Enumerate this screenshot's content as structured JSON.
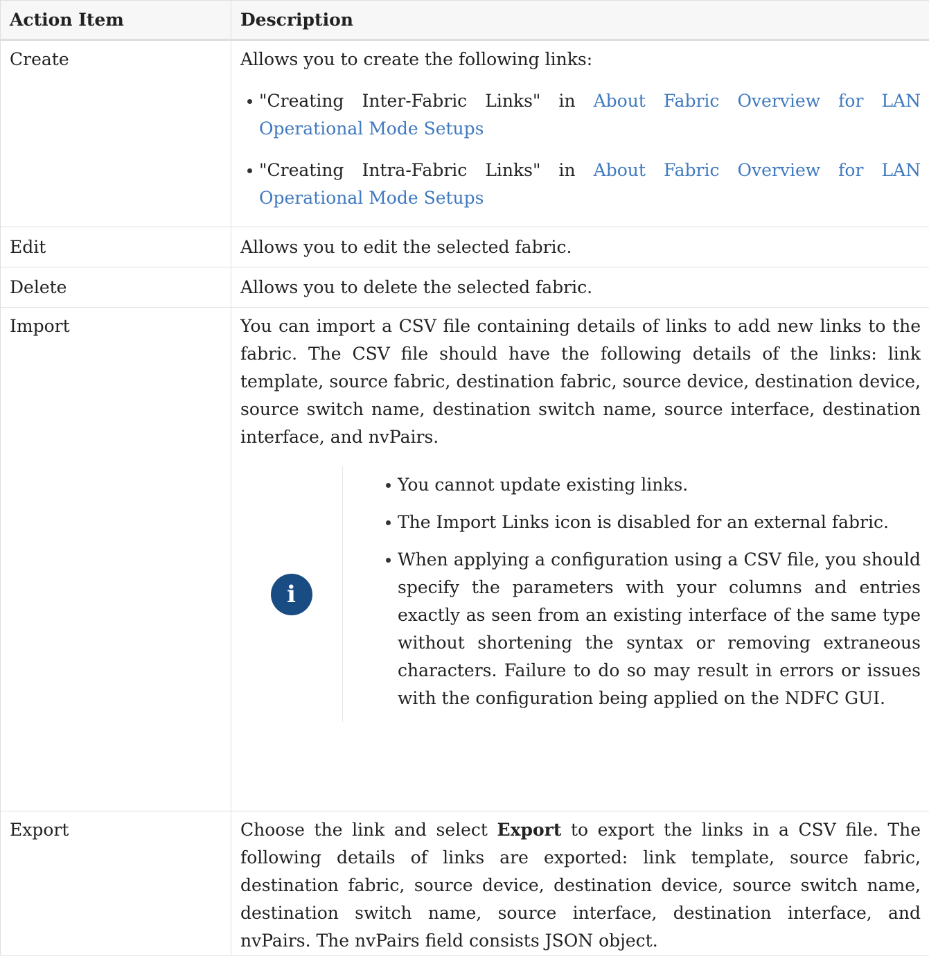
{
  "table": {
    "headers": [
      "Action Item",
      "Description"
    ],
    "create": {
      "action": "Create",
      "intro": "Allows you to create the following links:",
      "items": [
        {
          "prefix": "\"Creating Inter-Fabric Links\" in ",
          "link": "About Fabric Overview for LAN Operational Mode Setups"
        },
        {
          "prefix": "\"Creating Intra-Fabric Links\" in ",
          "link": "About Fabric Overview for LAN Operational Mode Setups"
        }
      ]
    },
    "edit": {
      "action": "Edit",
      "desc": "Allows you to edit the selected fabric."
    },
    "delete": {
      "action": "Delete",
      "desc": "Allows you to delete the selected fabric."
    },
    "import": {
      "action": "Import",
      "desc": "You can import a CSV file containing details of links to add new links to the fabric. The CSV file should have the following details of the links: link template, source fabric, destination fabric, source device, destination device, source switch name, destination switch name, source interface, destination interface, and nvPairs.",
      "note_icon": "info-icon",
      "note_items": [
        "You cannot update existing links.",
        "The Import Links icon is disabled for an external fabric.",
        "When applying a configuration using a CSV file, you should specify the parameters with your columns and entries exactly as seen from an existing interface of the same type without shortening the syntax or removing extraneous characters. Failure to do so may result in errors or issues with the configuration being applied on the NDFC GUI."
      ]
    },
    "export": {
      "action": "Export",
      "desc_before": "Choose the link and select ",
      "desc_bold": "Export",
      "desc_after": " to export the links in a CSV file. The following details of links are exported: link template, source fabric, destination fabric, source device, destination device, source switch name, destination switch name, source interface, destination interface, and nvPairs. The nvPairs field consists JSON object."
    }
  },
  "colors": {
    "link": "#3f79bf",
    "icon_bg": "#1a4c84",
    "border": "#dedede"
  }
}
